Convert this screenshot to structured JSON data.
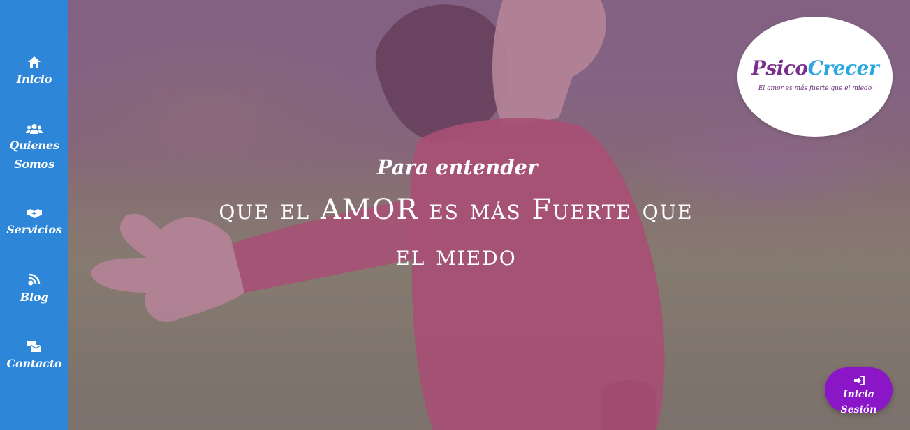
{
  "nav": {
    "items": [
      {
        "label_lines": [
          "Inicio"
        ],
        "icon": "home-icon"
      },
      {
        "label_lines": [
          "Quienes",
          "Somos"
        ],
        "icon": "users-icon"
      },
      {
        "label_lines": [
          "Servicios"
        ],
        "icon": "handshake-icon"
      },
      {
        "label_lines": [
          "Blog"
        ],
        "icon": "rss-icon"
      },
      {
        "label_lines": [
          "Contacto"
        ],
        "icon": "mail-bulk-icon"
      }
    ]
  },
  "hero": {
    "kicker": "Para entender",
    "headline_line1": "que el AMOR es más Fuerte que",
    "headline_line2": "el miedo"
  },
  "logo": {
    "title_part1": "Psico",
    "title_part2": "Crecer",
    "tagline": "El amor es más fuerte que el miedo"
  },
  "login": {
    "label": "Inicia Sesión",
    "icon": "sign-in-icon"
  },
  "colors": {
    "sidebar": "#2e86d8",
    "login_button": "#8a16c8",
    "logo_purple": "#7b2f8c",
    "logo_blue": "#2aa7e0"
  }
}
